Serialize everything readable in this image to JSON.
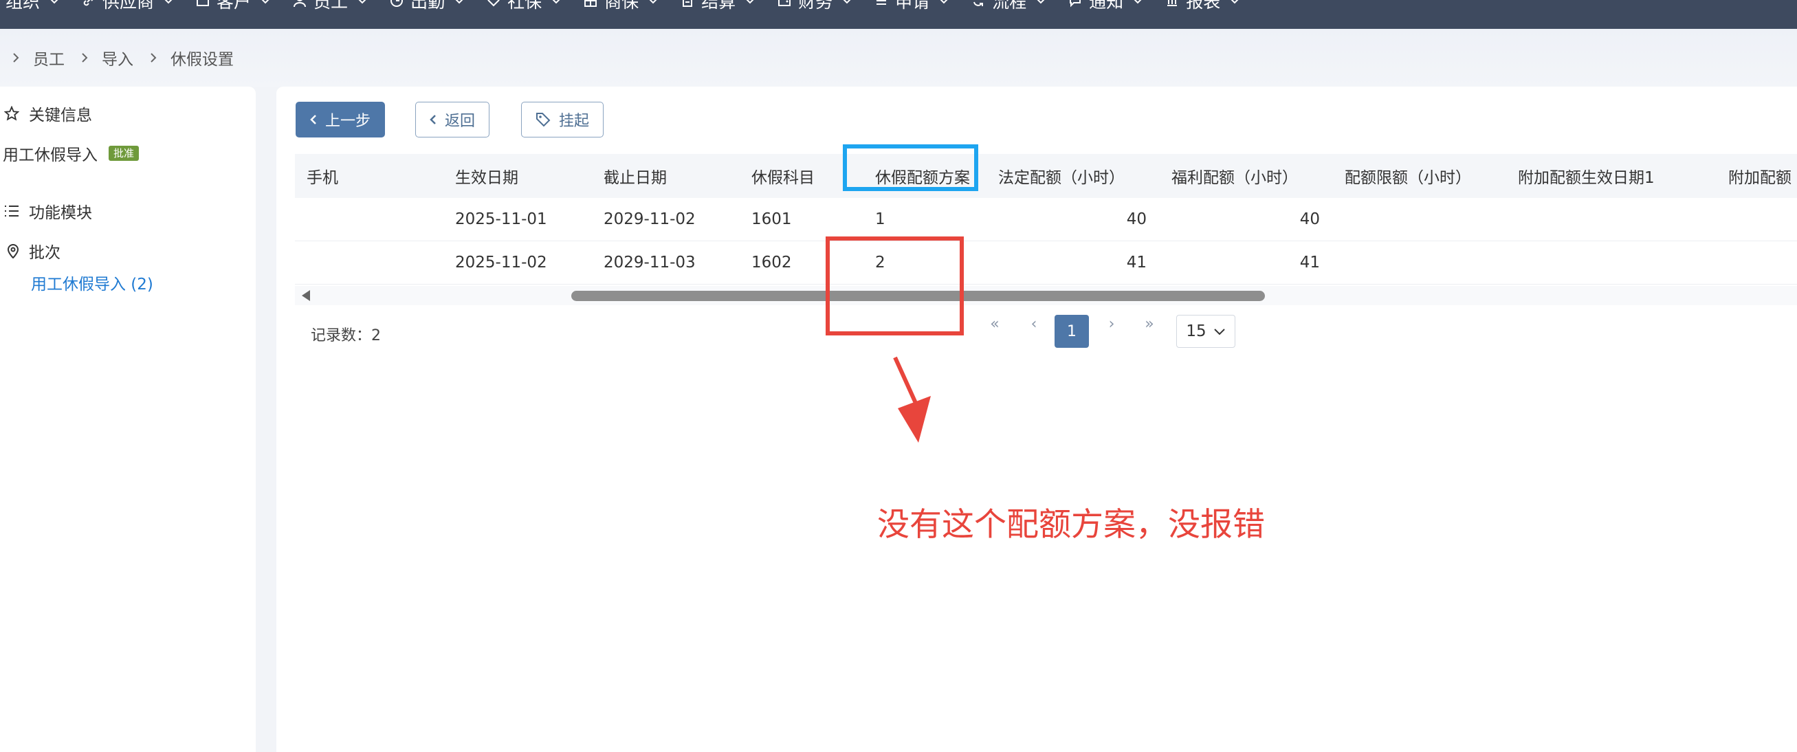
{
  "nav": {
    "items": [
      {
        "label": "组织",
        "icon": "none"
      },
      {
        "label": "供应商",
        "icon": "link-icon"
      },
      {
        "label": "客户",
        "icon": "briefcase-icon"
      },
      {
        "label": "员工",
        "icon": "user-icon"
      },
      {
        "label": "出勤",
        "icon": "clock-icon"
      },
      {
        "label": "社保",
        "icon": "heart-icon"
      },
      {
        "label": "商保",
        "icon": "grid-icon"
      },
      {
        "label": "结算",
        "icon": "clipboard-icon"
      },
      {
        "label": "财务",
        "icon": "wallet-icon"
      },
      {
        "label": "申请",
        "icon": "list-icon"
      },
      {
        "label": "流程",
        "icon": "refresh-icon"
      },
      {
        "label": "通知",
        "icon": "chat-icon"
      },
      {
        "label": "报表",
        "icon": "bar-chart-icon"
      }
    ]
  },
  "breadcrumb": [
    "员工",
    "导入",
    "休假设置"
  ],
  "left_panel": {
    "key_info_label": "关键信息",
    "import_name": "用工休假导入",
    "badge": "批准",
    "modules_label": "功能模块",
    "batch_label": "批次",
    "batch_link": "用工休假导入 (2)"
  },
  "toolbar": {
    "prev_label": "上一步",
    "back_label": "返回",
    "suspend_label": "挂起"
  },
  "table": {
    "columns": [
      "手机",
      "生效日期",
      "截止日期",
      "休假科目",
      "休假配额方案",
      "法定配额（小时）",
      "福利配额（小时）",
      "配额限额（小时）",
      "附加配额生效日期1",
      "附加配额"
    ],
    "rows": [
      [
        "",
        "2025-11-01",
        "2029-11-02",
        "1601",
        "1",
        "40",
        "40"
      ],
      [
        "",
        "2025-11-02",
        "2029-11-03",
        "1602",
        "2",
        "41",
        "41"
      ]
    ]
  },
  "pagination": {
    "records_text": "记录数：2",
    "current_page": "1",
    "page_size": "15",
    "first": "«",
    "prev": "‹",
    "next": "›",
    "last": "»"
  },
  "annotation": {
    "text": "没有这个配额方案，没报错",
    "colors": {
      "highlight": "#1ea5f0",
      "error": "#e8453c"
    }
  }
}
